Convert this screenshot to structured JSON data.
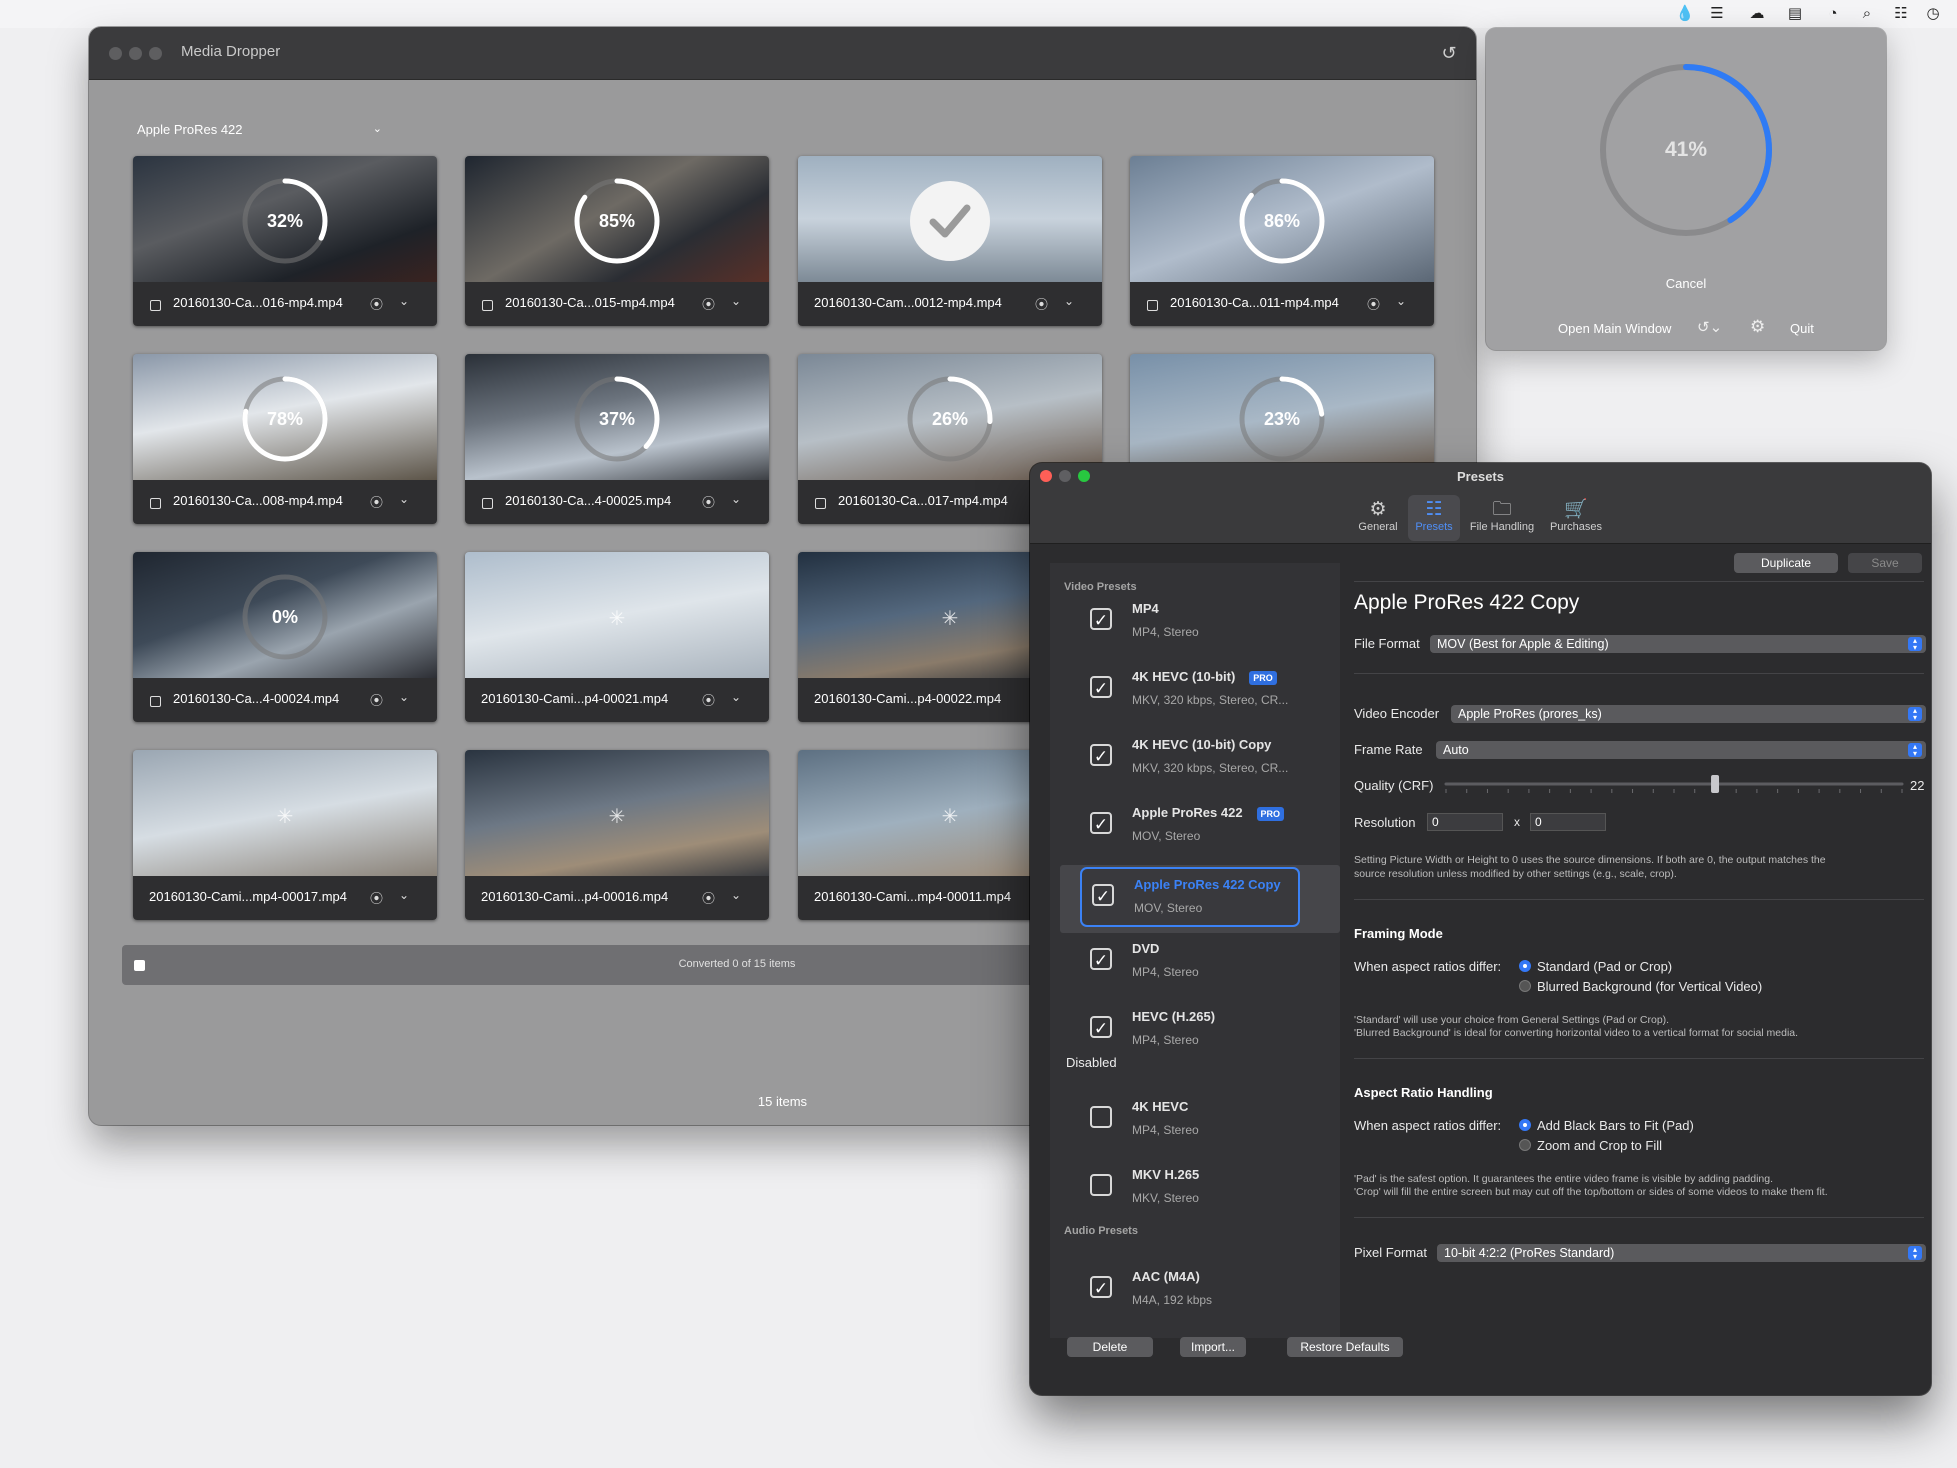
{
  "menubar": {
    "icons": [
      "dropper-icon",
      "stack-icon",
      "cloud-icon",
      "bed-icon",
      "wifi-icon",
      "search-icon",
      "control-center-icon",
      "clock-icon"
    ]
  },
  "main_window": {
    "title": "Media Dropper",
    "preset_select": "Apple ProRes 422",
    "status": "Converted 0 of 15 items",
    "items_count": "15 items",
    "cards": [
      {
        "name": "20160130-Ca...016-mp4.mp4",
        "progress": 32,
        "label": "32%",
        "state": "progress",
        "checkbox": true
      },
      {
        "name": "20160130-Ca...015-mp4.mp4",
        "progress": 85,
        "label": "85%",
        "state": "progress",
        "checkbox": true
      },
      {
        "name": "20160130-Cam...0012-mp4.mp4",
        "progress": 100,
        "label": "",
        "state": "done",
        "checkbox": false
      },
      {
        "name": "20160130-Ca...011-mp4.mp4",
        "progress": 86,
        "label": "86%",
        "state": "progress",
        "checkbox": true
      },
      {
        "name": "20160130-Ca...008-mp4.mp4",
        "progress": 78,
        "label": "78%",
        "state": "progress",
        "checkbox": true
      },
      {
        "name": "20160130-Ca...4-00025.mp4",
        "progress": 37,
        "label": "37%",
        "state": "progress",
        "checkbox": true
      },
      {
        "name": "20160130-Ca...017-mp4.mp4",
        "progress": 26,
        "label": "26%",
        "state": "progress",
        "checkbox": true
      },
      {
        "name": "",
        "progress": 23,
        "label": "23%",
        "state": "progress",
        "checkbox": false
      },
      {
        "name": "20160130-Ca...4-00024.mp4",
        "progress": 0,
        "label": "0%",
        "state": "progress",
        "checkbox": true
      },
      {
        "name": "20160130-Cami...p4-00021.mp4",
        "progress": 0,
        "label": "",
        "state": "waiting",
        "checkbox": false
      },
      {
        "name": "20160130-Cami...p4-00022.mp4",
        "progress": 0,
        "label": "",
        "state": "waiting",
        "checkbox": false
      },
      {
        "name": "",
        "progress": 0,
        "label": "",
        "state": "hidden",
        "checkbox": false
      },
      {
        "name": "20160130-Cami...mp4-00017.mp4",
        "progress": 0,
        "label": "",
        "state": "waiting",
        "checkbox": false
      },
      {
        "name": "20160130-Cami...p4-00016.mp4",
        "progress": 0,
        "label": "",
        "state": "waiting",
        "checkbox": false
      },
      {
        "name": "20160130-Cami...mp4-00011.mp4",
        "progress": 0,
        "label": "",
        "state": "waiting",
        "checkbox": false
      }
    ]
  },
  "mini_window": {
    "progress": 41,
    "progress_label": "41%",
    "cancel": "Cancel",
    "open_main": "Open Main Window",
    "quit": "Quit",
    "accent": "#2f7bf5"
  },
  "presets_window": {
    "title": "Presets",
    "tabs": [
      {
        "label": "General",
        "icon": "gear-icon",
        "active": false
      },
      {
        "label": "Presets",
        "icon": "list-icon",
        "active": true
      },
      {
        "label": "File Handling",
        "icon": "folder-icon",
        "active": false
      },
      {
        "label": "Purchases",
        "icon": "cart-icon",
        "active": false
      }
    ],
    "sections": {
      "video": "Video Presets",
      "disabled": "Disabled",
      "audio": "Audio Presets"
    },
    "presets": [
      {
        "name": "MP4",
        "sub": "MP4, Stereo",
        "checked": true,
        "pro": false
      },
      {
        "name": "4K HEVC (10-bit)",
        "sub": "MKV, 320 kbps, Stereo, CR...",
        "checked": true,
        "pro": true
      },
      {
        "name": "4K HEVC (10-bit) Copy",
        "sub": "MKV, 320 kbps, Stereo, CR...",
        "checked": true,
        "pro": false
      },
      {
        "name": "Apple ProRes 422",
        "sub": "MOV, Stereo",
        "checked": true,
        "pro": true
      },
      {
        "name": "Apple ProRes 422 Copy",
        "sub": "MOV, Stereo",
        "checked": true,
        "pro": false,
        "selected": true
      },
      {
        "name": "DVD",
        "sub": "MP4, Stereo",
        "checked": true,
        "pro": false
      },
      {
        "name": "HEVC (H.265)",
        "sub": "MP4, Stereo",
        "checked": true,
        "pro": false
      }
    ],
    "disabled_presets": [
      {
        "name": "4K HEVC",
        "sub": "MP4, Stereo",
        "checked": false
      },
      {
        "name": "MKV H.265",
        "sub": "MKV, Stereo",
        "checked": false
      }
    ],
    "audio_presets": [
      {
        "name": "AAC (M4A)",
        "sub": "M4A, 192 kbps",
        "checked": true
      }
    ],
    "pro_badge": "PRO",
    "buttons": {
      "delete": "Delete",
      "import": "Import...",
      "restore": "Restore Defaults",
      "duplicate": "Duplicate",
      "save": "Save"
    },
    "detail": {
      "title": "Apple ProRes 422 Copy",
      "file_format_label": "File Format",
      "file_format": "MOV (Best for Apple & Editing)",
      "video_encoder_label": "Video Encoder",
      "video_encoder": "Apple ProRes (prores_ks)",
      "frame_rate_label": "Frame Rate",
      "frame_rate": "Auto",
      "quality_label": "Quality (CRF)",
      "quality_value": "22",
      "quality_position": 0.59,
      "resolution_label": "Resolution",
      "res_w": "0",
      "res_x": "x",
      "res_h": "0",
      "res_note1": "Setting Picture Width or Height to 0 uses the source dimensions. If both are 0, the output matches the",
      "res_note2": "source resolution unless modified by other settings (e.g., scale, crop).",
      "framing_head": "Framing Mode",
      "framing_label": "When aspect ratios differ:",
      "framing_opt1": "Standard (Pad or Crop)",
      "framing_opt2": "Blurred Background (for Vertical Video)",
      "framing_note1": "'Standard' will use your choice from General Settings (Pad or Crop).",
      "framing_note2": "'Blurred Background' is ideal for converting horizontal video to a vertical format for social media.",
      "aspect_head": "Aspect Ratio Handling",
      "aspect_label": "When aspect ratios differ:",
      "aspect_opt1": "Add Black Bars to Fit (Pad)",
      "aspect_opt2": "Zoom and Crop to Fill",
      "aspect_note1": "'Pad' is the safest option. It guarantees the entire video frame is visible by adding padding.",
      "aspect_note2": "'Crop' will fill the entire screen but may cut off the top/bottom or sides of some videos to make them fit.",
      "pixel_format_label": "Pixel Format",
      "pixel_format": "10-bit 4:2:2 (ProRes Standard)"
    }
  }
}
